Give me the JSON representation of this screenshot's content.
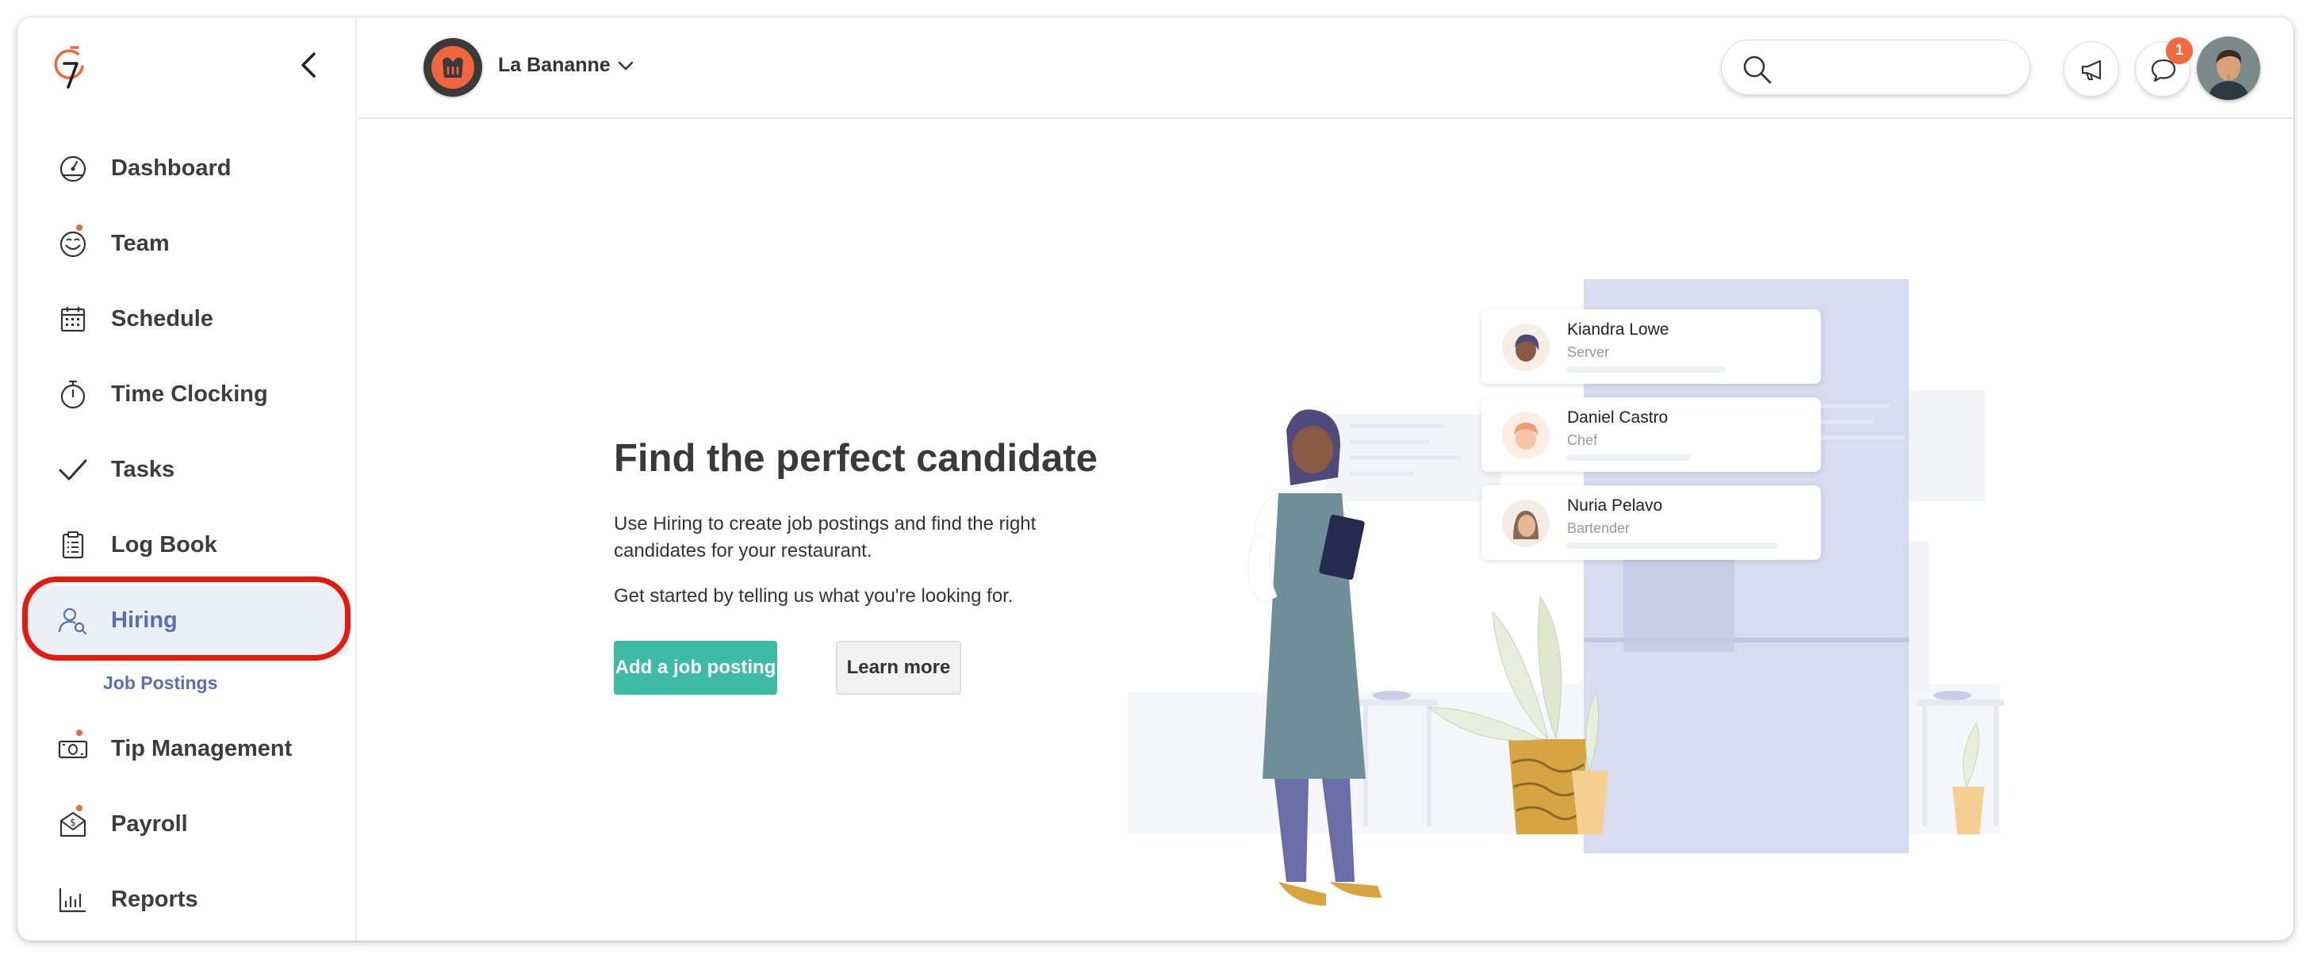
{
  "sidebar": {
    "items": [
      {
        "label": "Dashboard"
      },
      {
        "label": "Team"
      },
      {
        "label": "Schedule"
      },
      {
        "label": "Time Clocking"
      },
      {
        "label": "Tasks"
      },
      {
        "label": "Log Book"
      },
      {
        "label": "Hiring",
        "active": true
      },
      {
        "label": "Tip Management"
      },
      {
        "label": "Payroll"
      },
      {
        "label": "Reports"
      }
    ],
    "subitem": "Job Postings"
  },
  "header": {
    "location_name": "La Bananne",
    "search_placeholder": "",
    "notification_count": "1"
  },
  "hero": {
    "title": "Find the perfect candidate",
    "description": "Use Hiring to create job postings and find the right candidates for your restaurant.",
    "subtext": "Get started by telling us what you're looking for.",
    "primary_button": "Add a job posting",
    "secondary_button": "Learn more"
  },
  "candidates": [
    {
      "name": "Kiandra Lowe",
      "role": "Server"
    },
    {
      "name": "Daniel Castro",
      "role": "Chef"
    },
    {
      "name": "Nuria Pelavo",
      "role": "Bartender"
    }
  ],
  "colors": {
    "accent": "#3dbba6",
    "active_nav": "#5a6fb5",
    "badge": "#f26a3e",
    "highlight": "#e8190c"
  }
}
